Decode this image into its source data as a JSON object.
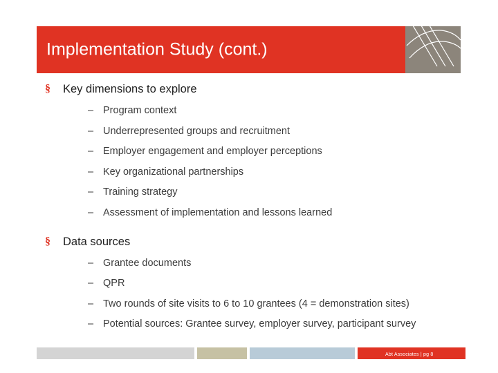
{
  "slide": {
    "title": "Implementation Study (cont.)",
    "sections": [
      {
        "heading": "Key dimensions to explore",
        "items": [
          "Program context",
          "Underrepresented groups and recruitment",
          "Employer engagement and employer perceptions",
          "Key organizational partnerships",
          "Training strategy",
          "Assessment of implementation and lessons learned"
        ]
      },
      {
        "heading": "Data sources",
        "items": [
          "Grantee documents",
          "QPR",
          "Two rounds of site visits to 6 to 10 grantees (4 = demonstration sites)",
          "Potential sources:  Grantee survey, employer survey, participant survey"
        ]
      }
    ],
    "bullet_marker": "§",
    "dash_marker": "–",
    "footer_text": "Abt Associates | pg 8",
    "colors": {
      "title_bar": "#E03323",
      "title_deco": "#8C857B",
      "strip_gray": "#D4D4D4",
      "strip_tan": "#C6C1A4",
      "strip_blue": "#B8CBD8",
      "strip_red": "#E03323"
    }
  }
}
